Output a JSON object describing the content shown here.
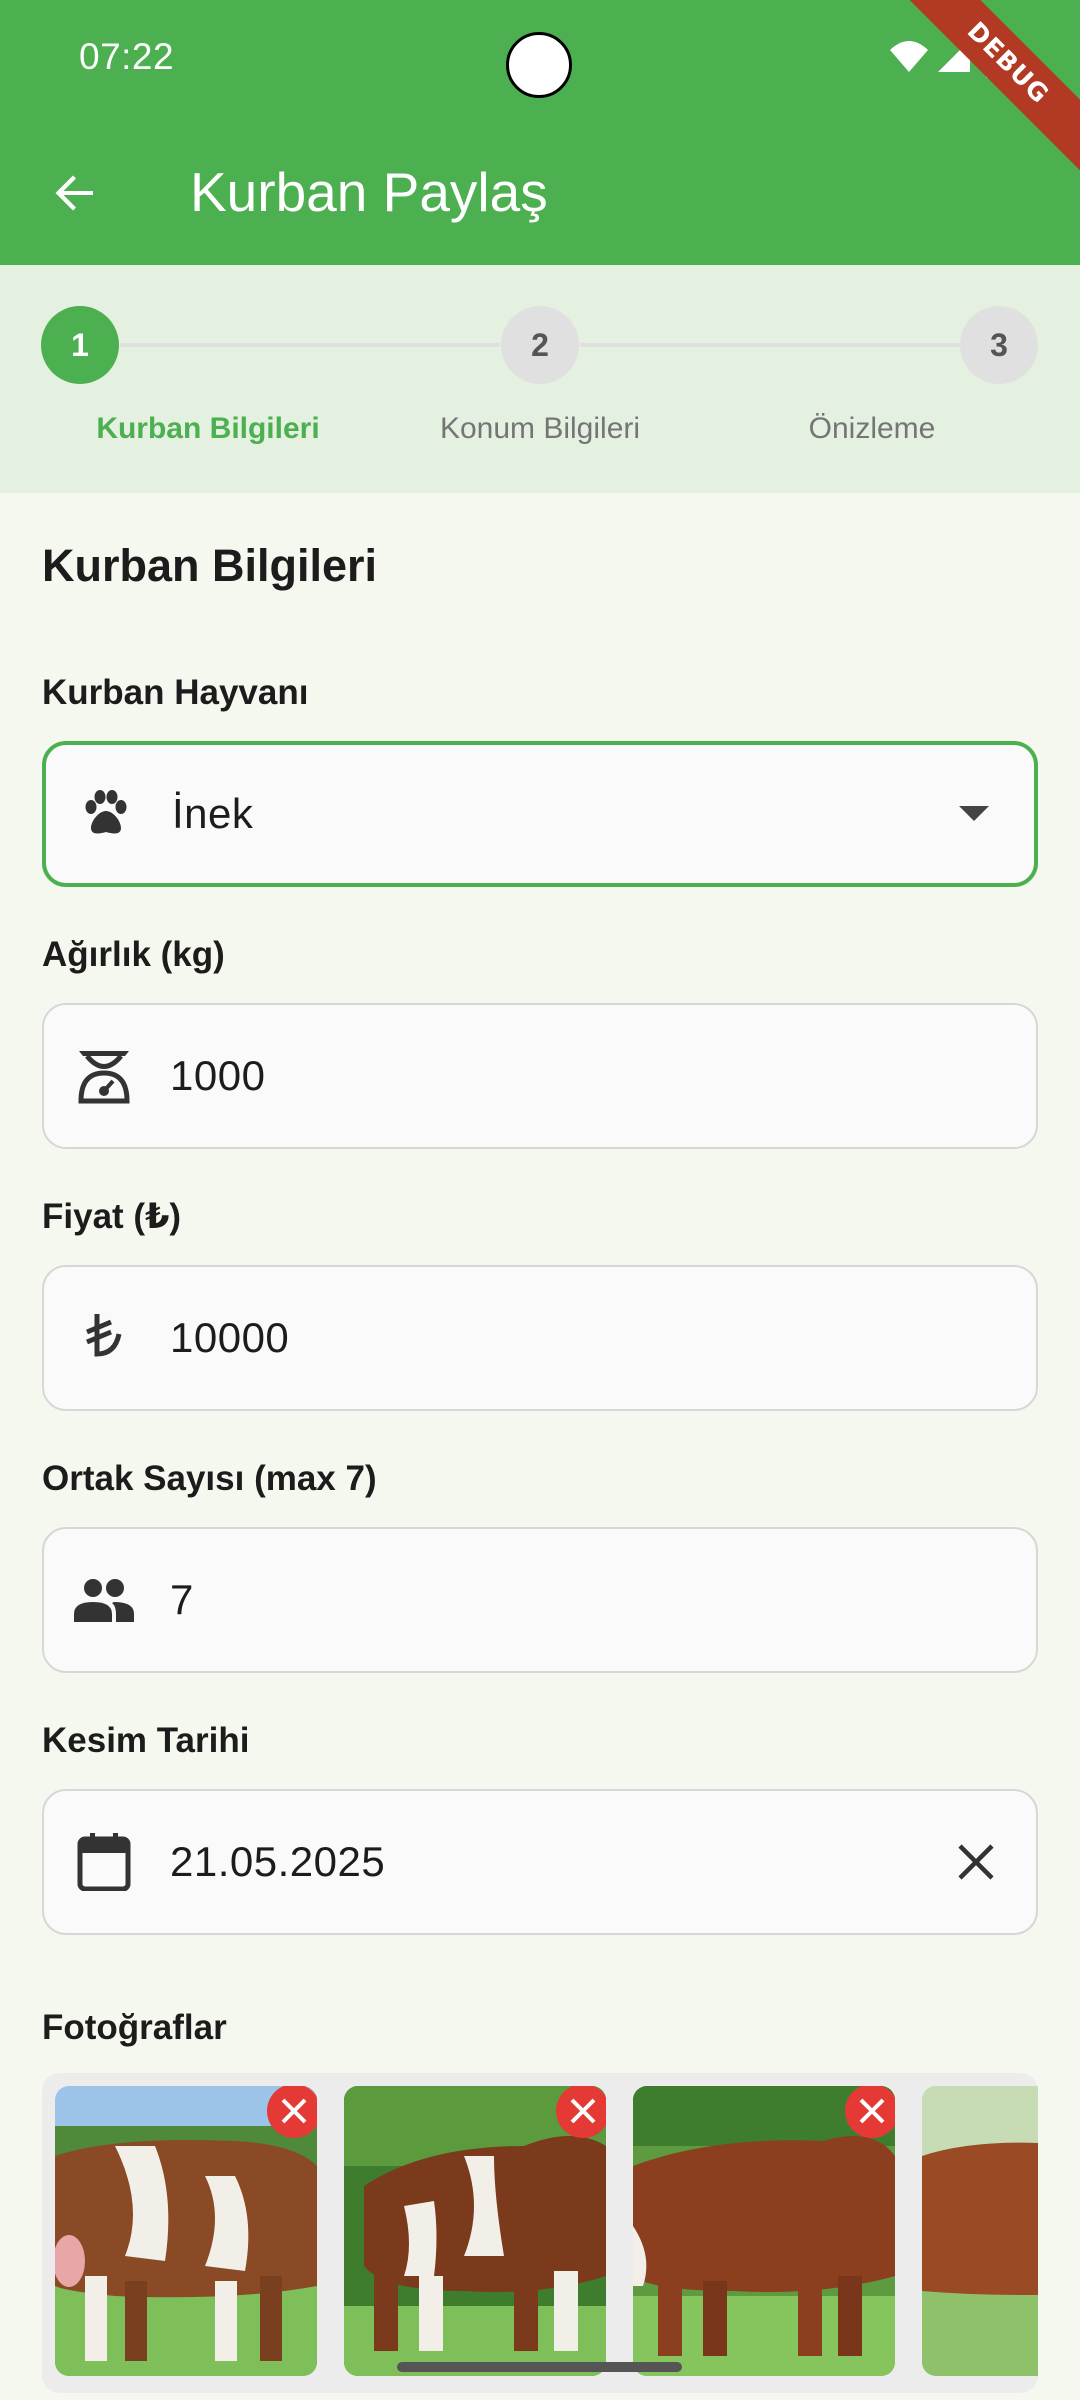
{
  "status_bar": {
    "time": "07:22",
    "debug_label": "DEBUG"
  },
  "appbar": {
    "title": "Kurban Paylaş",
    "back_icon": "arrow-back-icon"
  },
  "stepper": {
    "steps": [
      {
        "number": "1",
        "label": "Kurban Bilgileri",
        "active": true
      },
      {
        "number": "2",
        "label": "Konum Bilgileri",
        "active": false
      },
      {
        "number": "3",
        "label": "Önizleme",
        "active": false
      }
    ]
  },
  "form": {
    "section_title": "Kurban Bilgileri",
    "animal": {
      "label": "Kurban Hayvanı",
      "value": "İnek",
      "icon": "paw-icon",
      "trailing_icon": "dropdown-arrow-icon"
    },
    "weight": {
      "label": "Ağırlık (kg)",
      "value": "1000",
      "icon": "scale-icon"
    },
    "price": {
      "label": "Fiyat (₺)",
      "value": "10000",
      "icon": "lira-icon"
    },
    "partners": {
      "label": "Ortak Sayısı (max 7)",
      "value": "7",
      "icon": "people-icon"
    },
    "date": {
      "label": "Kesim Tarihi",
      "value": "21.05.2025",
      "icon": "calendar-icon",
      "trailing_icon": "clear-icon"
    },
    "photos": {
      "label": "Fotoğraflar",
      "count_visible": 4,
      "remove_icon": "remove-photo-icon"
    }
  },
  "colors": {
    "primary": "#4caf50",
    "stepper_bg": "#e5f1e0",
    "background": "#f5f8ef",
    "remove": "#e53935"
  }
}
